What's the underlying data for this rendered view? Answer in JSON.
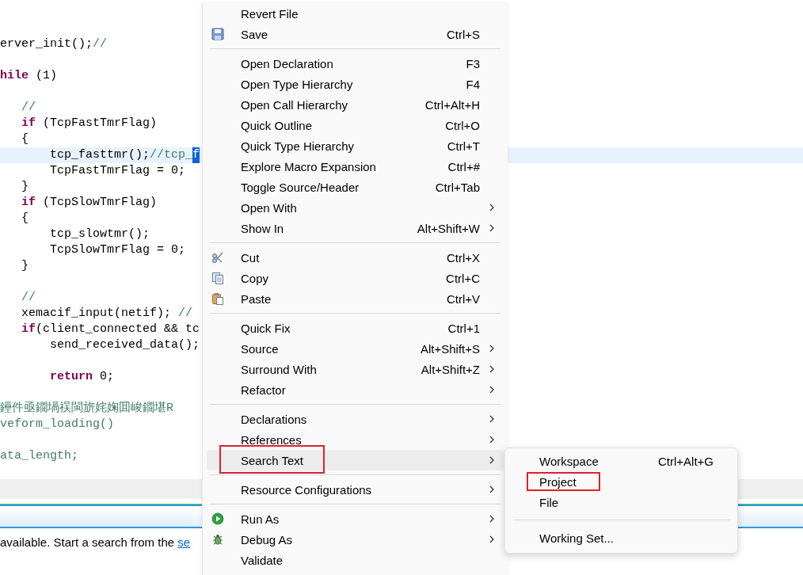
{
  "editor": {
    "lines": [
      {
        "current": false,
        "tokens": [
          {
            "kind": "code",
            "text": "erver_init();"
          },
          {
            "kind": "comment",
            "text": "//"
          }
        ]
      },
      {
        "current": false
      },
      {
        "current": false,
        "tokens": [
          {
            "kind": "keyword",
            "text": "hile"
          },
          {
            "kind": "code",
            "text": " (1)"
          }
        ]
      },
      {
        "current": false
      },
      {
        "current": false,
        "tokens": [
          {
            "kind": "comment",
            "text": "   //"
          }
        ]
      },
      {
        "current": false,
        "tokens": [
          {
            "kind": "keyword",
            "text": "   if"
          },
          {
            "kind": "code",
            "text": " (TcpFastTmrFlag)"
          }
        ]
      },
      {
        "current": false,
        "tokens": [
          {
            "kind": "code",
            "text": "   {"
          }
        ]
      },
      {
        "current": true,
        "tokens": [
          {
            "kind": "code",
            "text": "       tcp_fasttmr();"
          },
          {
            "kind": "comment",
            "text": "//tcp_"
          },
          {
            "kind": "selection",
            "text": "f"
          }
        ]
      },
      {
        "current": false,
        "tokens": [
          {
            "kind": "code",
            "text": "       TcpFastTmrFlag = 0;"
          }
        ]
      },
      {
        "current": false,
        "tokens": [
          {
            "kind": "code",
            "text": "   }"
          }
        ]
      },
      {
        "current": false,
        "tokens": [
          {
            "kind": "keyword",
            "text": "   if"
          },
          {
            "kind": "code",
            "text": " (TcpSlowTmrFlag)"
          }
        ]
      },
      {
        "current": false,
        "tokens": [
          {
            "kind": "code",
            "text": "   {"
          }
        ]
      },
      {
        "current": false,
        "tokens": [
          {
            "kind": "code",
            "text": "       tcp_slowtmr();"
          }
        ]
      },
      {
        "current": false,
        "tokens": [
          {
            "kind": "code",
            "text": "       TcpSlowTmrFlag = 0;"
          }
        ]
      },
      {
        "current": false,
        "tokens": [
          {
            "kind": "code",
            "text": "   }"
          }
        ]
      },
      {
        "current": false
      },
      {
        "current": false,
        "tokens": [
          {
            "kind": "comment",
            "text": "   //"
          }
        ]
      },
      {
        "current": false,
        "tokens": [
          {
            "kind": "code",
            "text": "   xemacif_input(netif); "
          },
          {
            "kind": "comment",
            "text": "//"
          }
        ]
      },
      {
        "current": false,
        "tokens": [
          {
            "kind": "keyword",
            "text": "   if"
          },
          {
            "kind": "code",
            "text": "(client_connected && tc"
          }
        ]
      },
      {
        "current": false,
        "tokens": [
          {
            "kind": "code",
            "text": "       send_received_data();"
          }
        ]
      },
      {
        "current": false
      },
      {
        "current": false,
        "tokens": [
          {
            "kind": "keyword",
            "text": "       return"
          },
          {
            "kind": "code",
            "text": " 0;"
          }
        ]
      },
      {
        "current": false
      },
      {
        "current": false,
        "tokens": [
          {
            "kind": "comment",
            "text": "鑸件亟鐗堝祦閩旂姹婅囬峻鐗堪R"
          }
        ]
      },
      {
        "current": false,
        "tokens": [
          {
            "kind": "comment",
            "text": "veform_loading()"
          }
        ]
      },
      {
        "current": false
      },
      {
        "current": false,
        "tokens": [
          {
            "kind": "comment",
            "text": "ata_length;"
          }
        ]
      }
    ]
  },
  "search_view": {
    "message": "available. Start a search from the ",
    "link": "se"
  },
  "context_menu": {
    "items": [
      {
        "kind": "item",
        "label": "Revert File",
        "submenu": false,
        "highlighted": false,
        "annotated": false
      },
      {
        "kind": "save",
        "label": "Save",
        "shortcut": "Ctrl+S",
        "submenu": false,
        "highlighted": false,
        "annotated": false
      },
      {
        "kind": "separator"
      },
      {
        "kind": "item",
        "label": "Open Declaration",
        "shortcut": "F3",
        "submenu": false,
        "highlighted": false,
        "annotated": false
      },
      {
        "kind": "item",
        "label": "Open Type Hierarchy",
        "shortcut": "F4",
        "submenu": false,
        "highlighted": false,
        "annotated": false
      },
      {
        "kind": "item",
        "label": "Open Call Hierarchy",
        "shortcut": "Ctrl+Alt+H",
        "submenu": false,
        "highlighted": false,
        "annotated": false
      },
      {
        "kind": "item",
        "label": "Quick Outline",
        "shortcut": "Ctrl+O",
        "submenu": false,
        "highlighted": false,
        "annotated": false
      },
      {
        "kind": "item",
        "label": "Quick Type Hierarchy",
        "shortcut": "Ctrl+T",
        "submenu": false,
        "highlighted": false,
        "annotated": false
      },
      {
        "kind": "item",
        "label": "Explore Macro Expansion",
        "shortcut": "Ctrl+#",
        "submenu": false,
        "highlighted": false,
        "annotated": false
      },
      {
        "kind": "item",
        "label": "Toggle Source/Header",
        "shortcut": "Ctrl+Tab",
        "submenu": false,
        "highlighted": false,
        "annotated": false
      },
      {
        "kind": "item",
        "label": "Open With",
        "submenu": true,
        "highlighted": false,
        "annotated": false
      },
      {
        "kind": "item",
        "label": "Show In",
        "shortcut": "Alt+Shift+W",
        "submenu": true,
        "highlighted": false,
        "annotated": false
      },
      {
        "kind": "separator"
      },
      {
        "kind": "cut",
        "label": "Cut",
        "shortcut": "Ctrl+X",
        "submenu": false,
        "highlighted": false,
        "annotated": false
      },
      {
        "kind": "copy",
        "label": "Copy",
        "shortcut": "Ctrl+C",
        "submenu": false,
        "highlighted": false,
        "annotated": false
      },
      {
        "kind": "paste",
        "label": "Paste",
        "shortcut": "Ctrl+V",
        "submenu": false,
        "highlighted": false,
        "annotated": false
      },
      {
        "kind": "separator"
      },
      {
        "kind": "item",
        "label": "Quick Fix",
        "shortcut": "Ctrl+1",
        "submenu": false,
        "highlighted": false,
        "annotated": false
      },
      {
        "kind": "item",
        "label": "Source",
        "shortcut": "Alt+Shift+S",
        "submenu": true,
        "highlighted": false,
        "annotated": false
      },
      {
        "kind": "item",
        "label": "Surround With",
        "shortcut": "Alt+Shift+Z",
        "submenu": true,
        "highlighted": false,
        "annotated": false
      },
      {
        "kind": "item",
        "label": "Refactor",
        "submenu": true,
        "highlighted": false,
        "annotated": false
      },
      {
        "kind": "separator"
      },
      {
        "kind": "item",
        "label": "Declarations",
        "submenu": true,
        "highlighted": false,
        "annotated": false
      },
      {
        "kind": "item",
        "label": "References",
        "submenu": true,
        "highlighted": false,
        "annotated": false
      },
      {
        "kind": "item",
        "label": "Search Text",
        "submenu": true,
        "highlighted": true,
        "annotated": true
      },
      {
        "kind": "separator"
      },
      {
        "kind": "item",
        "label": "Resource Configurations",
        "submenu": true,
        "highlighted": false,
        "annotated": false
      },
      {
        "kind": "separator"
      },
      {
        "kind": "run",
        "label": "Run As",
        "submenu": true,
        "highlighted": false,
        "annotated": false
      },
      {
        "kind": "debug",
        "label": "Debug As",
        "submenu": true,
        "highlighted": false,
        "annotated": false
      },
      {
        "kind": "item",
        "label": "Validate",
        "submenu": false,
        "highlighted": false,
        "annotated": false
      }
    ]
  },
  "submenu": {
    "items": [
      {
        "kind": "item",
        "label": "Workspace",
        "shortcut": "Ctrl+Alt+G",
        "submenu": false,
        "highlighted": false,
        "annotated": false
      },
      {
        "kind": "item",
        "label": "Project",
        "submenu": false,
        "highlighted": false,
        "annotated": true
      },
      {
        "kind": "item",
        "label": "File",
        "submenu": false,
        "highlighted": false,
        "annotated": false
      },
      {
        "kind": "separator"
      },
      {
        "kind": "item",
        "label": "Working Set...",
        "submenu": false,
        "highlighted": false,
        "annotated": false
      }
    ]
  }
}
